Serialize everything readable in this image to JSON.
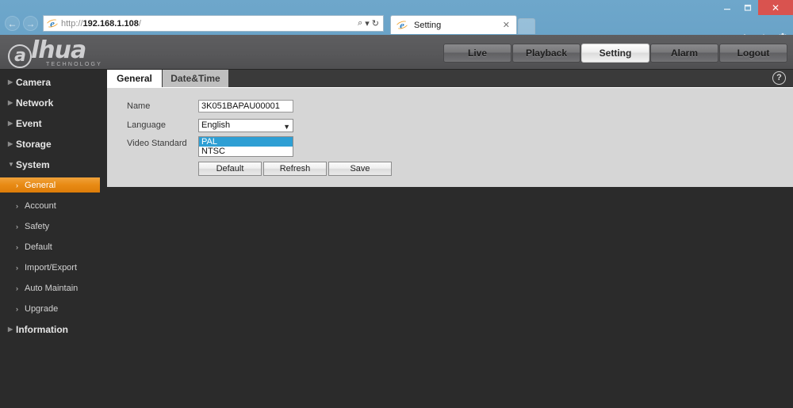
{
  "browser": {
    "window_controls": {
      "minimize": "minimize-icon",
      "restore": "restore-icon",
      "close": "✕"
    },
    "back_arrow": "←",
    "forward_arrow": "→",
    "url_prefix": "http://",
    "url_host": "192.168.1.108",
    "url_suffix": "/",
    "search_icon": "⌕",
    "search_caret": "▾",
    "refresh_icon": "↻",
    "tab_title": "Setting",
    "tab_close": "✕",
    "right_icons": {
      "home": "home-icon",
      "favorites": "star-icon",
      "tools": "gear-icon"
    }
  },
  "header": {
    "logo_letter": "a",
    "logo_text": "lhua",
    "logo_sub": "TECHNOLOGY",
    "nav": [
      {
        "label": "Live",
        "active": false
      },
      {
        "label": "Playback",
        "active": false
      },
      {
        "label": "Setting",
        "active": true
      },
      {
        "label": "Alarm",
        "active": false
      },
      {
        "label": "Logout",
        "active": false
      }
    ]
  },
  "sidebar": {
    "groups": [
      {
        "label": "Camera",
        "expanded": false,
        "marker": "▶"
      },
      {
        "label": "Network",
        "expanded": false,
        "marker": "▶"
      },
      {
        "label": "Event",
        "expanded": false,
        "marker": "▶"
      },
      {
        "label": "Storage",
        "expanded": false,
        "marker": "▶"
      },
      {
        "label": "System",
        "expanded": true,
        "marker": "▼"
      }
    ],
    "system_items": [
      {
        "label": "General",
        "active": true,
        "marker": "›"
      },
      {
        "label": "Account",
        "active": false,
        "marker": "›"
      },
      {
        "label": "Safety",
        "active": false,
        "marker": "›"
      },
      {
        "label": "Default",
        "active": false,
        "marker": "›"
      },
      {
        "label": "Import/Export",
        "active": false,
        "marker": "›"
      },
      {
        "label": "Auto Maintain",
        "active": false,
        "marker": "›"
      },
      {
        "label": "Upgrade",
        "active": false,
        "marker": "›"
      }
    ],
    "footer_group": {
      "label": "Information",
      "marker": "▶"
    }
  },
  "content": {
    "tabs": [
      {
        "label": "General",
        "active": true
      },
      {
        "label": "Date&Time",
        "active": false
      }
    ],
    "help_glyph": "?",
    "form": {
      "name_label": "Name",
      "name_value": "3K051BAPAU00001",
      "language_label": "Language",
      "language_value": "English",
      "language_caret": "▼",
      "video_standard_label": "Video Standard",
      "video_standard_options": [
        {
          "label": "PAL",
          "selected": true
        },
        {
          "label": "NTSC",
          "selected": false
        }
      ]
    },
    "buttons": [
      {
        "label": "Default"
      },
      {
        "label": "Refresh"
      },
      {
        "label": "Save"
      }
    ]
  },
  "colors": {
    "accent_orange": "#e88a14",
    "select_blue": "#2e9fd4",
    "page_bg": "#2b2b2b",
    "panel_bg": "#d6d6d6",
    "browser_blue": "#6aa3c8",
    "close_red": "#d9534f"
  }
}
